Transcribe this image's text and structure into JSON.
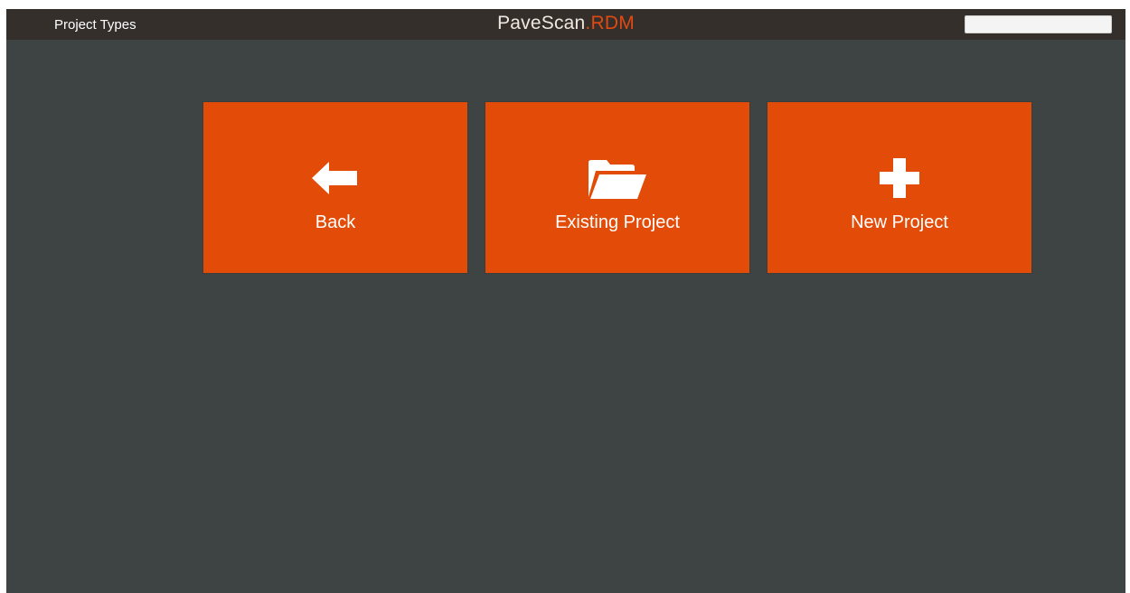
{
  "header": {
    "title": "Project Types",
    "brand_main": "PaveScan",
    "brand_dot": ".",
    "brand_accent": "RDM",
    "search_value": ""
  },
  "tiles": [
    {
      "label": "Back",
      "icon": "arrow-left-icon"
    },
    {
      "label": "Existing Project",
      "icon": "folder-open-icon"
    },
    {
      "label": "New Project",
      "icon": "plus-icon"
    }
  ],
  "colors": {
    "tile": "#e24c08",
    "accent": "#e04a12",
    "background": "#3e4443",
    "topbar": "#352f2c"
  }
}
